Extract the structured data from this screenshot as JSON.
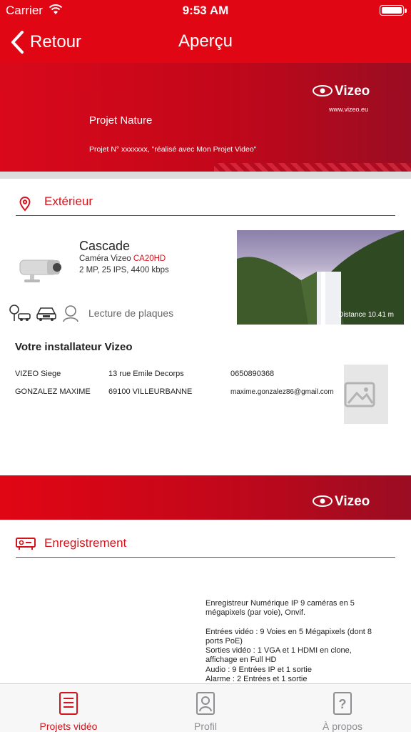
{
  "status_bar": {
    "carrier": "Carrier",
    "time": "9:53 AM"
  },
  "nav": {
    "back_label": "Retour",
    "title": "Aperçu"
  },
  "banner": {
    "project_name": "Projet Nature",
    "project_sub": "Projet N° xxxxxxx, \"réalisé avec Mon Projet Video\"",
    "logo_text": "Vizeo",
    "website": "www.vizeo.eu"
  },
  "exterior": {
    "section_title": "Extérieur",
    "camera": {
      "name": "Cascade",
      "model_prefix": "Caméra Vizeo",
      "model_code": "CA20HD",
      "specs": "2 MP, 25 IPS, 4400 kbps",
      "usage_label": "Lecture de plaques"
    },
    "photo_distance": "Distance 10.41 m"
  },
  "installer": {
    "title": "Votre installateur Vizeo",
    "company": "VIZEO Siege",
    "contact": "GONZALEZ  MAXIME",
    "address1": "13 rue Emile Decorps",
    "address2": "69100 VILLEURBANNE",
    "phone": "0650890368",
    "email": "maxime.gonzalez86@gmail.com"
  },
  "banner2": {
    "logo_text": "Vizeo"
  },
  "recording": {
    "section_title": "Enregistrement",
    "lines": [
      "Enregistreur Numérique IP 9 caméras en 5",
      "mégapixels (par voie), Onvif.",
      "",
      "Entrées vidéo : 9 Voies en 5 Mégapixels (dont 8",
      "ports PoE)",
      "Sorties vidéo : 1 VGA et 1 HDMI en clone,",
      "affichage en Full HD",
      "Audio : 9 Entrées IP et 1 sortie",
      "Alarme : 2 Entrées et 1 sortie"
    ]
  },
  "tabs": [
    {
      "label": "Projets vidéo",
      "icon": "document-icon",
      "active": true
    },
    {
      "label": "Profil",
      "icon": "profile-icon",
      "active": false
    },
    {
      "label": "À propos",
      "icon": "question-icon",
      "active": false
    }
  ],
  "colors": {
    "brand_red": "#e10614",
    "accent_red": "#d5131c",
    "dark_red": "#9a0d22"
  }
}
